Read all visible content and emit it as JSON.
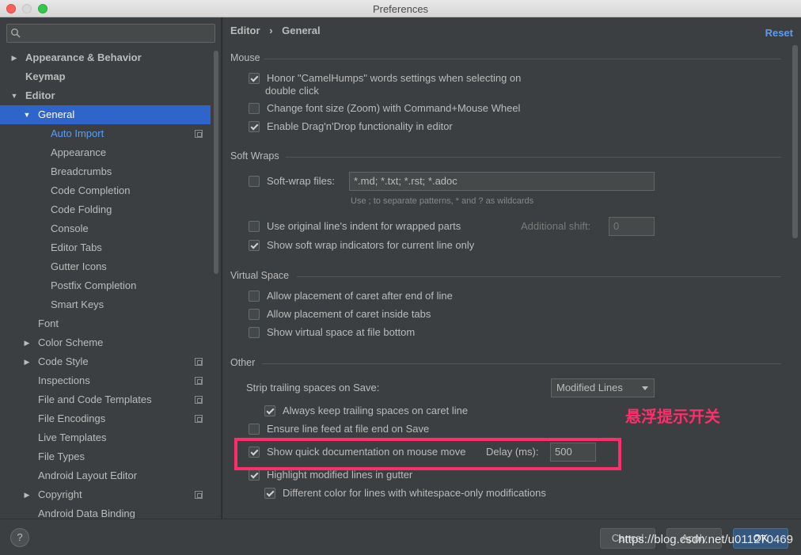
{
  "window": {
    "title": "Preferences"
  },
  "search": {
    "placeholder": ""
  },
  "sidebar": {
    "items": [
      {
        "label": "Appearance & Behavior",
        "arrow": "▶"
      },
      {
        "label": "Keymap",
        "arrow": ""
      },
      {
        "label": "Editor",
        "arrow": "▼"
      },
      {
        "label": "General",
        "arrow": "▼"
      },
      {
        "label": "Auto Import"
      },
      {
        "label": "Appearance"
      },
      {
        "label": "Breadcrumbs"
      },
      {
        "label": "Code Completion"
      },
      {
        "label": "Code Folding"
      },
      {
        "label": "Console"
      },
      {
        "label": "Editor Tabs"
      },
      {
        "label": "Gutter Icons"
      },
      {
        "label": "Postfix Completion"
      },
      {
        "label": "Smart Keys"
      },
      {
        "label": "Font"
      },
      {
        "label": "Color Scheme",
        "arrow": "▶"
      },
      {
        "label": "Code Style",
        "arrow": "▶"
      },
      {
        "label": "Inspections"
      },
      {
        "label": "File and Code Templates"
      },
      {
        "label": "File Encodings"
      },
      {
        "label": "Live Templates"
      },
      {
        "label": "File Types"
      },
      {
        "label": "Android Layout Editor"
      },
      {
        "label": "Copyright",
        "arrow": "▶"
      },
      {
        "label": "Android Data Binding"
      }
    ]
  },
  "breadcrumb": {
    "parent": "Editor",
    "separator": "›",
    "current": "General"
  },
  "reset_label": "Reset",
  "sections": {
    "mouse": {
      "title": "Mouse",
      "opt1": "Honor \"CamelHumps\" words settings when selecting on",
      "opt1b": "double click",
      "opt2": "Change font size (Zoom) with Command+Mouse Wheel",
      "opt3": "Enable Drag'n'Drop functionality in editor"
    },
    "soft_wraps": {
      "title": "Soft Wraps",
      "files_label": "Soft-wrap files:",
      "files_value": "*.md; *.txt; *.rst; *.adoc",
      "files_hint": "Use ; to separate patterns, * and ? as wildcards",
      "indent": "Use original line's indent for wrapped parts",
      "additional_shift_label": "Additional shift:",
      "additional_shift_value": "0",
      "indicators": "Show soft wrap indicators for current line only"
    },
    "virtual_space": {
      "title": "Virtual Space",
      "opt1": "Allow placement of caret after end of line",
      "opt2": "Allow placement of caret inside tabs",
      "opt3": "Show virtual space at file bottom"
    },
    "other": {
      "title": "Other",
      "strip_label": "Strip trailing spaces on Save:",
      "strip_value": "Modified Lines",
      "keep_trailing": "Always keep trailing spaces on caret line",
      "ensure_feed": "Ensure line feed at file end on Save",
      "quick_doc": "Show quick documentation on mouse move",
      "delay_label": "Delay (ms):",
      "delay_value": "500",
      "highlight_modified": "Highlight modified lines in gutter",
      "different_color": "Different color for lines with whitespace-only modifications"
    }
  },
  "annotation": "悬浮提示开关",
  "footer": {
    "help": "?",
    "cancel": "Cancel",
    "apply": "Apply",
    "ok": "OK",
    "watermark": "https://blog.csdn.net/u011270469"
  },
  "colors": {
    "accent": "#2f65ca",
    "link": "#589df6",
    "highlight": "#ff2d6c"
  }
}
